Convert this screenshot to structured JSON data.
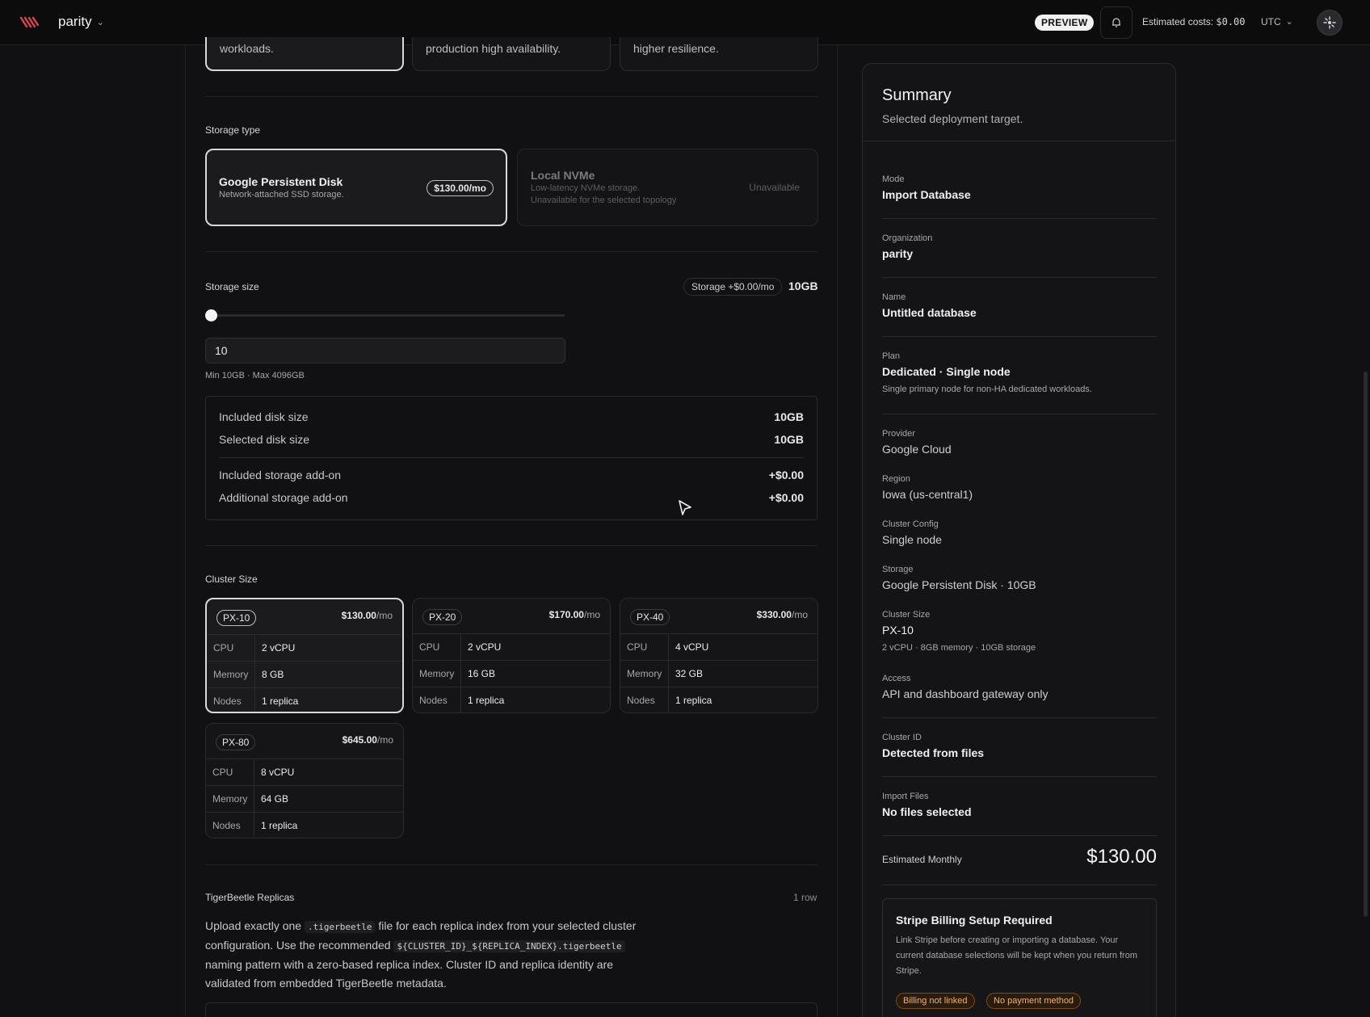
{
  "topbar": {
    "org_name": "parity",
    "preview_label": "PREVIEW",
    "estimated_costs_label": "Estimated costs:",
    "estimated_costs_value": "$0.00",
    "timezone": "UTC"
  },
  "plan_cards": [
    {
      "text": "workloads."
    },
    {
      "text": "production high availability."
    },
    {
      "text": "higher resilience."
    }
  ],
  "storage_type": {
    "label": "Storage type",
    "options": [
      {
        "title": "Google Persistent Disk",
        "subtitle": "Network-attached SSD storage.",
        "price": "$130.00/mo",
        "selected": true
      },
      {
        "title": "Local NVMe",
        "subtitle": "Low-latency NVMe storage.",
        "subtitle2": "Unavailable for the selected topology",
        "status": "Unavailable",
        "selected": false
      }
    ]
  },
  "storage_size": {
    "label": "Storage size",
    "pill": "Storage +$0.00/mo",
    "value_display": "10GB",
    "slider_fraction": 0.0,
    "input_value": "10",
    "hint": "Min 10GB · Max 4096GB",
    "breakdown": [
      {
        "label": "Included disk size",
        "value": "10GB"
      },
      {
        "label": "Selected disk size",
        "value": "10GB"
      },
      {
        "label": "Included storage add-on",
        "value": "+$0.00"
      },
      {
        "label": "Additional storage add-on",
        "value": "+$0.00"
      }
    ]
  },
  "cluster_size": {
    "label": "Cluster Size",
    "row_labels": {
      "cpu": "CPU",
      "memory": "Memory",
      "nodes": "Nodes"
    },
    "per": "/mo",
    "options": [
      {
        "name": "PX-10",
        "price": "$130.00",
        "cpu": "2 vCPU",
        "memory": "8 GB",
        "nodes": "1 replica",
        "selected": true
      },
      {
        "name": "PX-20",
        "price": "$170.00",
        "cpu": "2 vCPU",
        "memory": "16 GB",
        "nodes": "1 replica",
        "selected": false
      },
      {
        "name": "PX-40",
        "price": "$330.00",
        "cpu": "4 vCPU",
        "memory": "32 GB",
        "nodes": "1 replica",
        "selected": false
      },
      {
        "name": "PX-80",
        "price": "$645.00",
        "cpu": "8 vCPU",
        "memory": "64 GB",
        "nodes": "1 replica",
        "selected": false
      }
    ]
  },
  "replicas": {
    "title": "TigerBeetle Replicas",
    "count": "1 row",
    "text_1": "Upload exactly one",
    "code_1": ".tigerbeetle",
    "text_2": "file for each replica index from your selected cluster configuration. Use the recommended",
    "code_2": "${CLUSTER_ID}_${REPLICA_INDEX}.tigerbeetle",
    "text_3": "naming pattern with a zero-based replica index. Cluster ID and replica identity are validated from embedded TigerBeetle metadata."
  },
  "summary": {
    "title": "Summary",
    "subtitle": "Selected deployment target.",
    "mode_label": "Mode",
    "mode": "Import Database",
    "org_label": "Organization",
    "org": "parity",
    "name_label": "Name",
    "name": "Untitled database",
    "plan_label": "Plan",
    "plan": "Dedicated · Single node",
    "plan_desc": "Single primary node for non-HA dedicated workloads.",
    "provider_label": "Provider",
    "provider": "Google Cloud",
    "region_label": "Region",
    "region": "Iowa (us-central1)",
    "config_label": "Cluster Config",
    "config": "Single node",
    "storage_label": "Storage",
    "storage": "Google Persistent Disk · 10GB",
    "cluster_size_label": "Cluster Size",
    "cluster_size": "PX-10",
    "cluster_size_desc": "2 vCPU · 8GB memory · 10GB storage",
    "access_label": "Access",
    "access": "API and dashboard gateway only",
    "cluster_id_label": "Cluster ID",
    "cluster_id": "Detected from files",
    "import_files_label": "Import Files",
    "import_files": "No files selected",
    "estimated_monthly_label": "Estimated Monthly",
    "estimated_monthly": "$130.00",
    "stripe": {
      "title": "Stripe Billing Setup Required",
      "text": "Link Stripe before creating or importing a database. Your current database selections will be kept when you return from Stripe.",
      "badge_1": "Billing not linked",
      "badge_2": "No payment method"
    }
  },
  "colors": {
    "background": "#111113",
    "topbar": "#0c0c0d",
    "accent_logo": "#e0434b",
    "warning": "#f0b46a"
  },
  "icons": [
    "logo-icon",
    "chevron-down-icon",
    "bell-icon",
    "avatar-icon",
    "cursor-icon"
  ]
}
